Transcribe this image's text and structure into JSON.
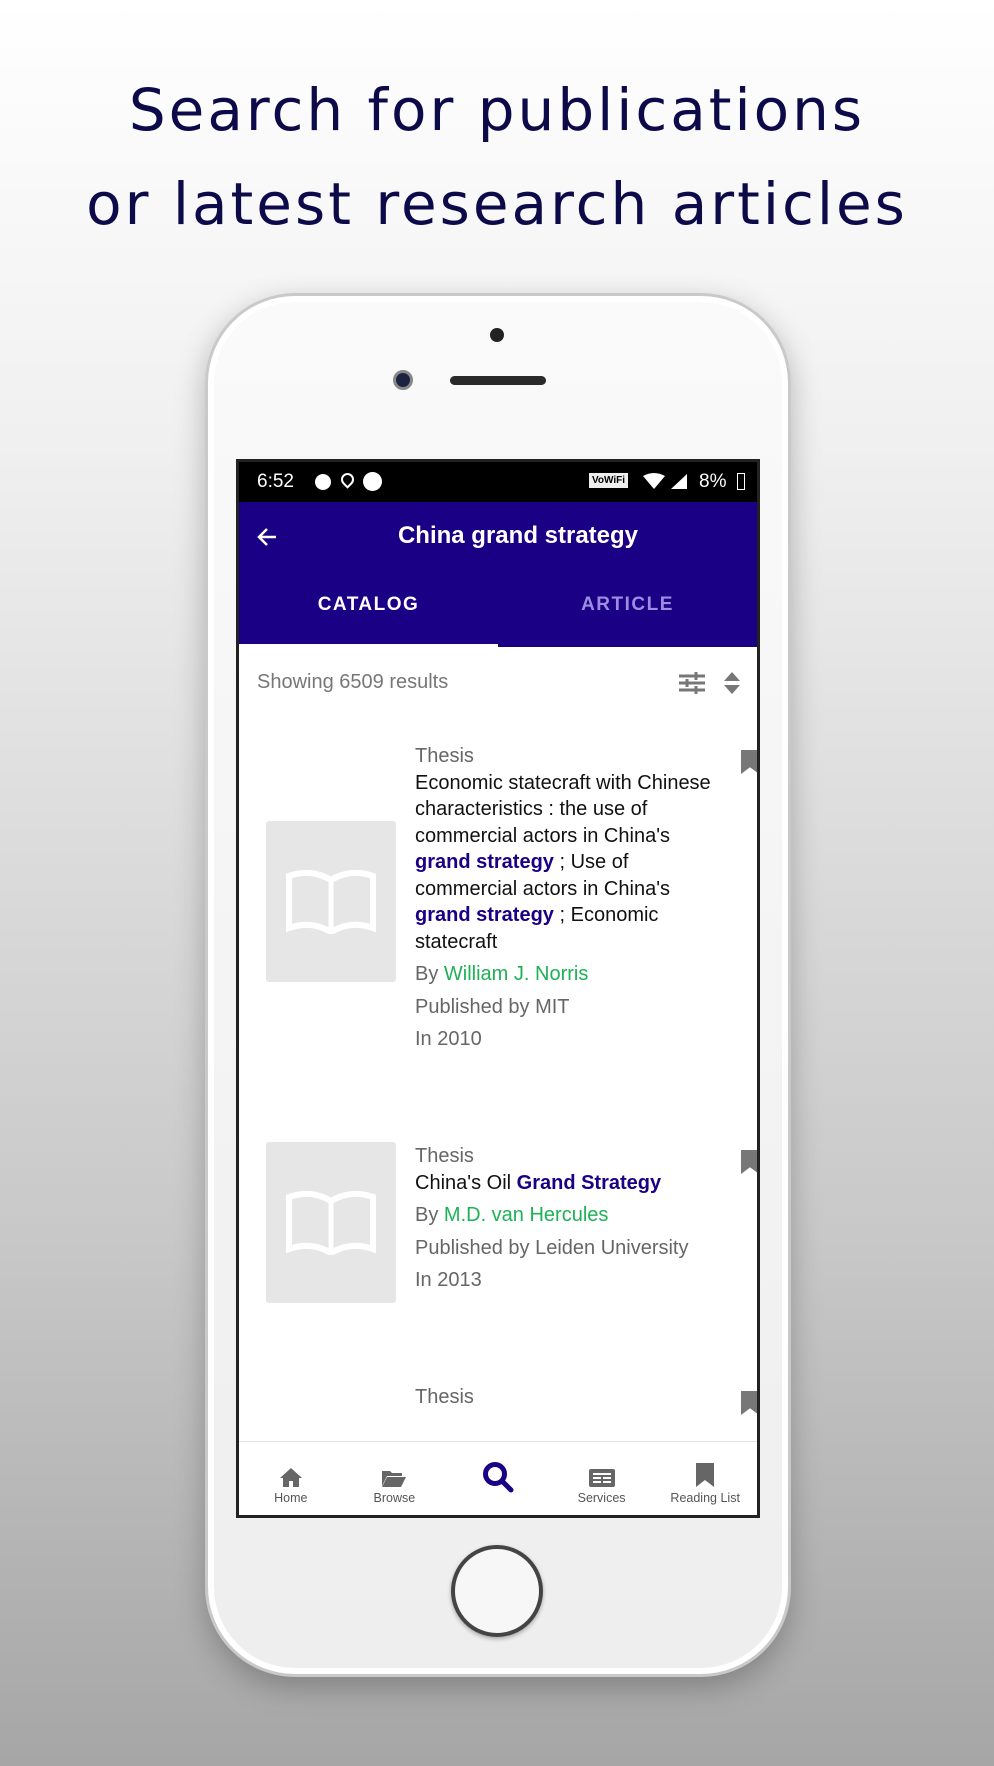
{
  "headline": [
    "Search for publications",
    "or latest research articles"
  ],
  "status": {
    "time": "6:52",
    "wifi_label": "VoWiFi",
    "battery": "8%"
  },
  "appbar": {
    "title": "China grand strategy",
    "tabs": [
      {
        "label": "CATALOG",
        "active": true
      },
      {
        "label": "ARTICLE",
        "active": false
      }
    ]
  },
  "results": {
    "count_text": "Showing 6509 results"
  },
  "items": [
    {
      "type": "Thesis",
      "title_parts": [
        "Economic statecraft with Chinese characteristics : the use of commercial actors in China's ",
        "grand strategy",
        " ; Use of commercial actors in China's ",
        "grand strategy",
        " ; Economic statecraft"
      ],
      "by": "By ",
      "author": "William J. Norris",
      "publisher": "Published by MIT",
      "year": "In 2010"
    },
    {
      "type": "Thesis",
      "title_parts": [
        "China's Oil ",
        "Grand Strategy"
      ],
      "by": "By ",
      "author": "M.D. van Hercules",
      "publisher": "Published by Leiden University",
      "year": "In 2013"
    },
    {
      "type": "Thesis"
    }
  ],
  "nav": [
    {
      "label": "Home",
      "icon": "home-icon"
    },
    {
      "label": "Browse",
      "icon": "folder-open-icon"
    },
    {
      "label": "",
      "icon": "search-icon",
      "active": true
    },
    {
      "label": "Services",
      "icon": "newspaper-icon"
    },
    {
      "label": "Reading List",
      "icon": "bookmark-icon"
    }
  ],
  "colors": {
    "primary": "#1a0085",
    "author": "#1db255",
    "headline": "#0d0a4a"
  }
}
